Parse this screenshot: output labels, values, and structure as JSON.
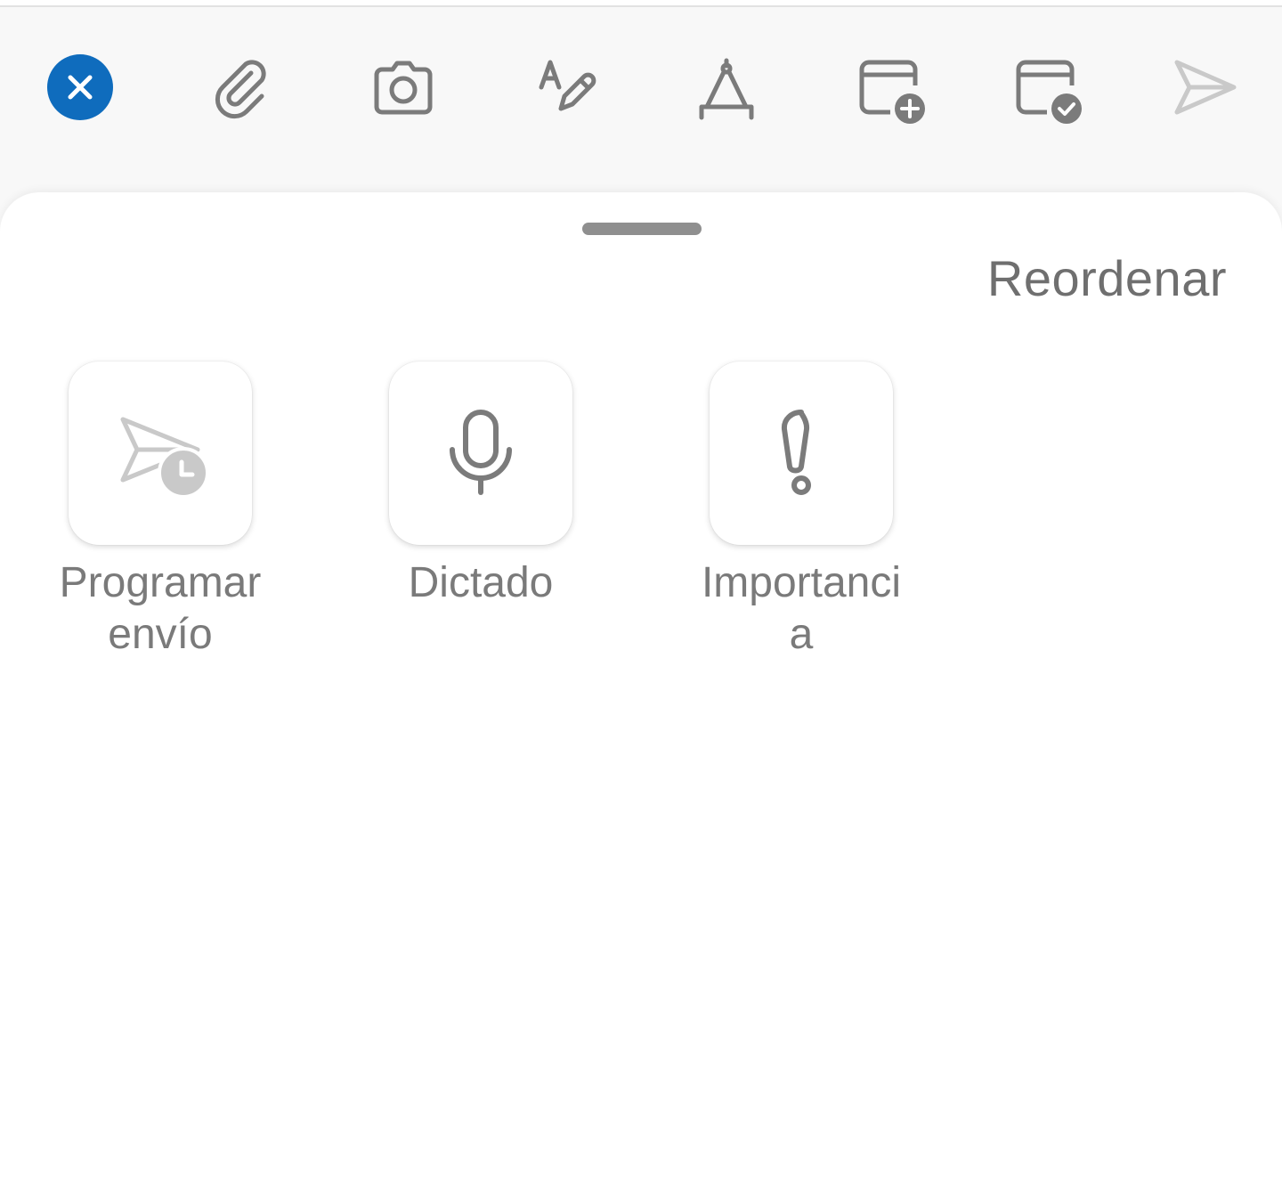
{
  "toolbar": {
    "icons": [
      {
        "name": "close-icon",
        "color": "#0f6cbd"
      },
      {
        "name": "paperclip-icon"
      },
      {
        "name": "camera-icon"
      },
      {
        "name": "text-format-icon"
      },
      {
        "name": "drawing-compass-icon"
      },
      {
        "name": "calendar-add-icon"
      },
      {
        "name": "calendar-check-icon"
      },
      {
        "name": "send-icon"
      }
    ]
  },
  "sheet": {
    "reorder_label": "Reordenar",
    "actions": [
      {
        "label": "Programar envío",
        "icon": "scheduled-send-icon"
      },
      {
        "label": "Dictado",
        "icon": "microphone-icon"
      },
      {
        "label": "Importancia",
        "icon": "exclamation-icon"
      }
    ]
  },
  "colors": {
    "accent": "#0f6cbd",
    "icon_gray": "#7b7b7b",
    "disabled_gray": "#c9c9c9",
    "label_gray": "#7a7a7a"
  }
}
